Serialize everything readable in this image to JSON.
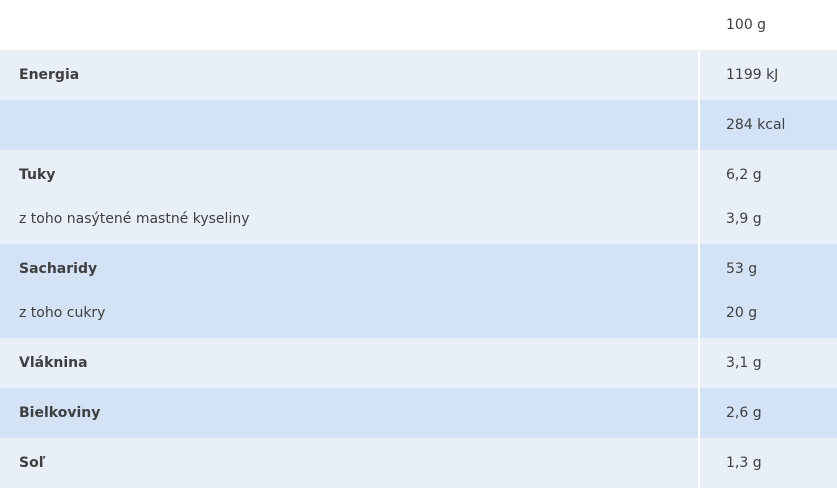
{
  "header": {
    "label": "",
    "value": "100 g"
  },
  "rows": [
    {
      "label": "Energia",
      "value": "1199 kJ"
    },
    {
      "label": "",
      "value": "284 kcal"
    },
    {
      "label": "Tuky",
      "value": "6,2 g",
      "sub_label": "z toho nasýtené mastné kyseliny",
      "sub_value": "3,9 g"
    },
    {
      "label": "Sacharidy",
      "value": "53 g",
      "sub_label": "z toho cukry",
      "sub_value": "20 g"
    },
    {
      "label": "Vláknina",
      "value": "3,1 g"
    },
    {
      "label": "Bielkoviny",
      "value": "2,6 g"
    },
    {
      "label": "Soľ",
      "value": "1,3 g"
    }
  ],
  "colors": {
    "light_row": "#e9eff7",
    "mid_row": "#d3e3f5",
    "text": "#3f3f3f"
  }
}
